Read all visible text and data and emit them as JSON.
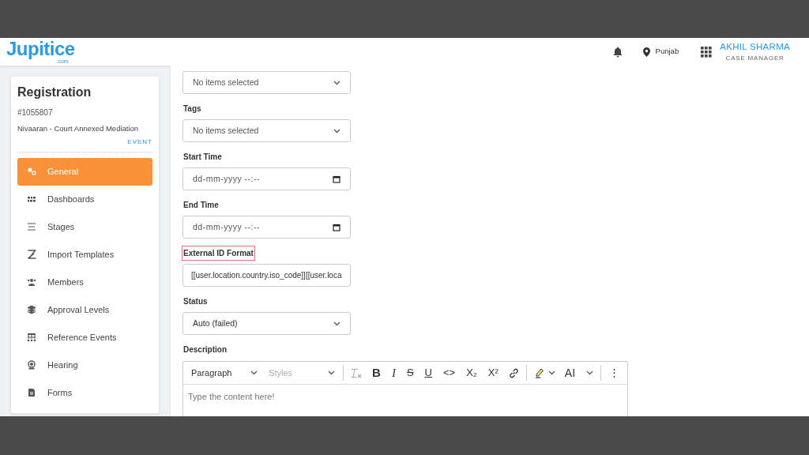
{
  "header": {
    "logo": "Jupitice",
    "logo_sub": ".com",
    "location": "Punjab",
    "user_name": "AKHIL SHARMA",
    "user_role": "CASE MANAGER"
  },
  "sidebar": {
    "title": "Registration",
    "number": "#1055807",
    "subtitle": "Nivaaran - Court Annexed Mediation",
    "type": "EVENT",
    "items": [
      {
        "label": "General",
        "selected": true
      },
      {
        "label": "Dashboards",
        "selected": false
      },
      {
        "label": "Stages",
        "selected": false
      },
      {
        "label": "Import Templates",
        "selected": false
      },
      {
        "label": "Members",
        "selected": false
      },
      {
        "label": "Approval Levels",
        "selected": false
      },
      {
        "label": "Reference Events",
        "selected": false
      },
      {
        "label": "Hearing",
        "selected": false
      },
      {
        "label": "Forms",
        "selected": false
      }
    ]
  },
  "form": {
    "fields": [
      {
        "kind": "multiselect",
        "placeholder": "No items selected"
      },
      {
        "kind": "multiselect",
        "label": "Tags",
        "placeholder": "No items selected"
      },
      {
        "kind": "datetime",
        "label": "Start Time",
        "value": "dd-mm-yyyy --:--"
      },
      {
        "kind": "datetime",
        "label": "End Time",
        "value": "dd-mm-yyyy --:--"
      },
      {
        "kind": "text",
        "label": "External ID Format",
        "highlighted": true,
        "value": "[[user.location.country.iso_code]][[user.loca"
      },
      {
        "kind": "select",
        "label": "Status",
        "value": "Auto (failed)"
      }
    ]
  },
  "editor": {
    "label": "Description",
    "placeholder": "Type the content here!",
    "toolbar": [
      {
        "kind": "dropdown",
        "label": "Paragraph",
        "disabled": false
      },
      {
        "kind": "dropdown",
        "label": "Styles",
        "disabled": true
      },
      {
        "kind": "separator"
      },
      {
        "kind": "icon",
        "disabled": true
      },
      {
        "kind": "text",
        "label": "B"
      },
      {
        "kind": "text",
        "label": "I"
      },
      {
        "kind": "text",
        "label": "S"
      },
      {
        "kind": "text",
        "label": "U"
      },
      {
        "kind": "text",
        "label": "<>"
      },
      {
        "kind": "text",
        "label": "X₂"
      },
      {
        "kind": "text",
        "label": "X²"
      },
      {
        "kind": "icon"
      },
      {
        "kind": "separator"
      },
      {
        "kind": "icon-dropdown"
      },
      {
        "kind": "text-dropdown",
        "label": "AI"
      },
      {
        "kind": "separator"
      },
      {
        "kind": "text",
        "label": "⋮"
      }
    ]
  }
}
